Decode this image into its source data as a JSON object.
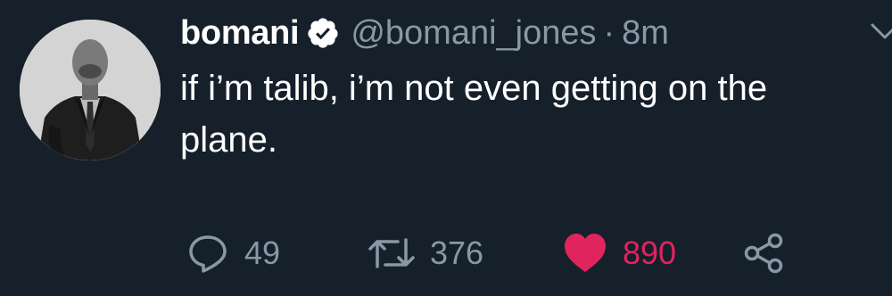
{
  "tweet": {
    "display_name": "bomani",
    "handle": "@bomani_jones",
    "separator": "·",
    "timestamp": "8m",
    "text": "if i’m talib, i’m not even getting on the plane.",
    "reply_count": "49",
    "retweet_count": "376",
    "like_count": "890"
  },
  "colors": {
    "background": "#15202b",
    "muted_text": "#8899a6",
    "like_active": "#e0245e",
    "verified_badge": "#ffffff"
  },
  "icons": {
    "verified": "verified-badge-icon",
    "menu": "chevron-down-icon",
    "reply": "reply-icon",
    "retweet": "retweet-icon",
    "like": "heart-icon",
    "share": "share-icon"
  }
}
